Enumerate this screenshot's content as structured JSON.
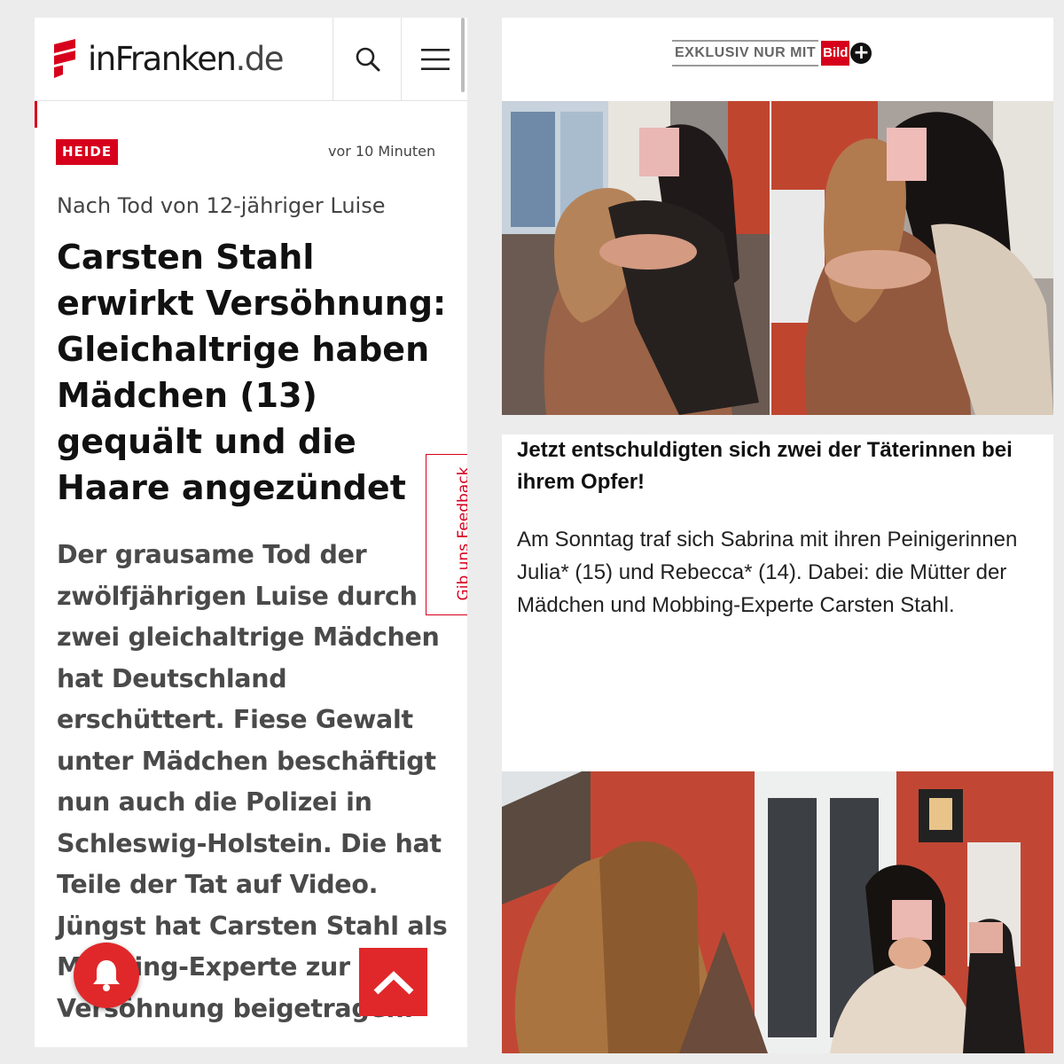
{
  "left_article": {
    "site_name": "inFranken",
    "site_tld": ".de",
    "category_badge": "HEIDE",
    "timestamp": "vor 10 Minuten",
    "kicker": "Nach Tod von 12-jähriger Luise",
    "headline": "Carsten Stahl erwirkt Versöhnung: Gleichaltrige haben Mädchen (13) gequält und die Haare angezündet",
    "teaser": "Der grausame Tod der zwölfjährigen Luise durch zwei gleichaltrige Mädchen hat Deutschland erschüttert. Fiese Gewalt unter Mädchen beschäftigt nun auch die Polizei in Schleswig-Holstein. Die hat Teile der Tat auf Video. Jüngst hat Carsten Stahl als Mobbing-Experte zur Versöhnung beigetragen.",
    "feedback_label": "Gib uns Feedback",
    "icons": {
      "search": "search-icon",
      "menu": "hamburger-menu-icon",
      "bell": "bell-icon",
      "scroll_top": "chevron-up-icon"
    },
    "brand_color": "#d6001c"
  },
  "right_article": {
    "exclusive_label": "EXKLUSIV NUR MIT",
    "bild_brand": "Bild",
    "bild_plus_glyph": "+",
    "caption": "Jetzt entschuldigten sich zwei der Täterinnen bei ihrem Opfer!",
    "body": "Am Sonntag traf sich Sabrina mit ihren Peinigerinnen Julia* (15) und Rebecca* (14). Dabei: die Mütter der Mädchen und Mobbing-Experte Carsten Stahl.",
    "brand_color": "#d6001c"
  }
}
